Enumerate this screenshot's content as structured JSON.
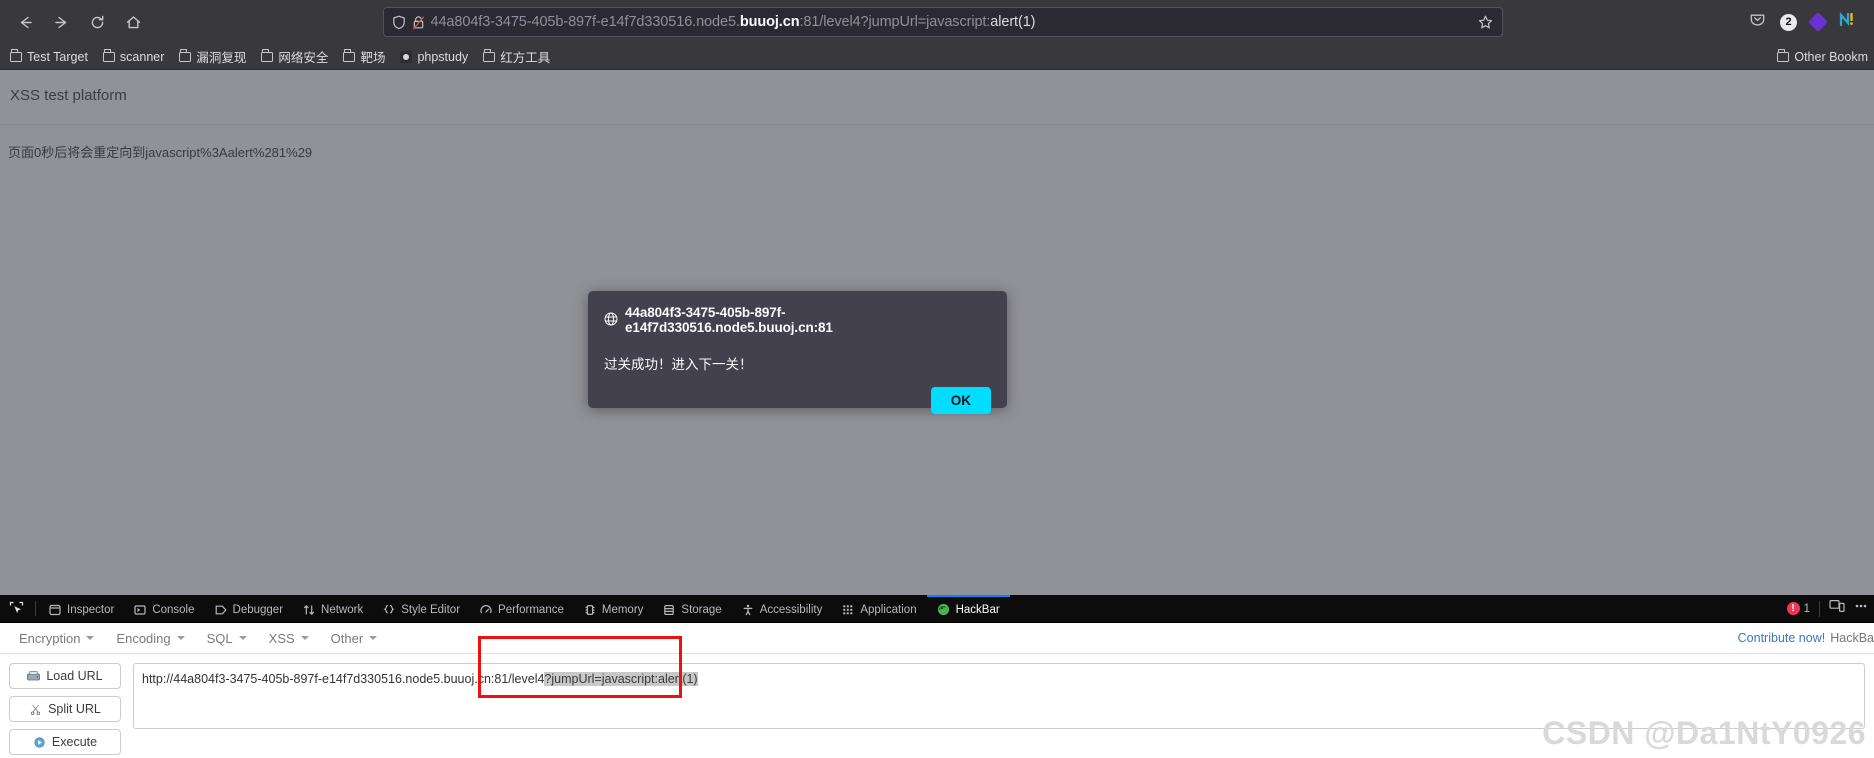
{
  "browser": {
    "nav": {
      "back_label": "Back",
      "forward_label": "Forward",
      "reload_label": "Reload",
      "home_label": "Home"
    },
    "url": {
      "prefix": "44a804f3-3475-405b-897f-e14f7d330516.node5.",
      "host": "buuoj.cn",
      "suffix": ":81/level4?jumpUrl=javascript:",
      "tail_bright": "alert(1)",
      "full": "44a804f3-3475-405b-897f-e14f7d330516.node5.buuoj.cn:81/level4?jumpUrl=javascript:alert(1)"
    },
    "extension_badge": "2",
    "bookmarks": [
      {
        "label": "Test Target",
        "icon": "folder-icon"
      },
      {
        "label": "scanner",
        "icon": "folder-icon"
      },
      {
        "label": "漏洞复现",
        "icon": "folder-icon"
      },
      {
        "label": "网络安全",
        "icon": "folder-icon"
      },
      {
        "label": "靶场",
        "icon": "folder-icon"
      },
      {
        "label": "phpstudy",
        "icon": "phpstudy-icon"
      },
      {
        "label": "红方工具",
        "icon": "folder-icon"
      }
    ],
    "other_bookmarks": "Other Bookm"
  },
  "page": {
    "title": "XSS test platform",
    "redirect_message": "页面0秒后将会重定向到javascript%3Aalert%281%29"
  },
  "dialog": {
    "origin": "44a804f3-3475-405b-897f-e14f7d330516.node5.buuoj.cn:81",
    "message": "过关成功！进入下一关！",
    "ok_label": "OK",
    "accent_color": "#00ddff",
    "background_color": "#42414d"
  },
  "devtools": {
    "tabs": [
      {
        "label": "Inspector",
        "icon": "inspector-icon",
        "active": false
      },
      {
        "label": "Console",
        "icon": "console-icon",
        "active": false
      },
      {
        "label": "Debugger",
        "icon": "debugger-icon",
        "active": false
      },
      {
        "label": "Network",
        "icon": "network-icon",
        "active": false
      },
      {
        "label": "Style Editor",
        "icon": "style-editor-icon",
        "active": false
      },
      {
        "label": "Performance",
        "icon": "performance-icon",
        "active": false
      },
      {
        "label": "Memory",
        "icon": "memory-icon",
        "active": false
      },
      {
        "label": "Storage",
        "icon": "storage-icon",
        "active": false
      },
      {
        "label": "Accessibility",
        "icon": "accessibility-icon",
        "active": false
      },
      {
        "label": "Application",
        "icon": "application-icon",
        "active": false
      },
      {
        "label": "HackBar",
        "icon": "hackbar-icon",
        "active": true
      }
    ],
    "error_count": "1",
    "active_tab_accent": "#0a84ff"
  },
  "hackbar": {
    "menu": [
      {
        "label": "Encryption"
      },
      {
        "label": "Encoding"
      },
      {
        "label": "SQL"
      },
      {
        "label": "XSS"
      },
      {
        "label": "Other"
      }
    ],
    "contribute_link": "Contribute now!",
    "contribute_suffix": "HackBa",
    "buttons": [
      {
        "label": "Load URL",
        "icon": "load-url-icon"
      },
      {
        "label": "Split URL",
        "icon": "split-url-icon"
      },
      {
        "label": "Execute",
        "icon": "execute-icon"
      }
    ],
    "url_value_plain": "http://44a804f3-3475-405b-897f-e14f7d330516.node5.buuoj.cn:81/level4",
    "url_value_selected": "?jumpUrl=javascript:alert(1)",
    "url_value_full": "http://44a804f3-3475-405b-897f-e14f7d330516.node5.buuoj.cn:81/level4?jumpUrl=javascript:alert(1)",
    "highlight_color": "#ee1111"
  },
  "watermark": "CSDN @Da1NtY0926"
}
